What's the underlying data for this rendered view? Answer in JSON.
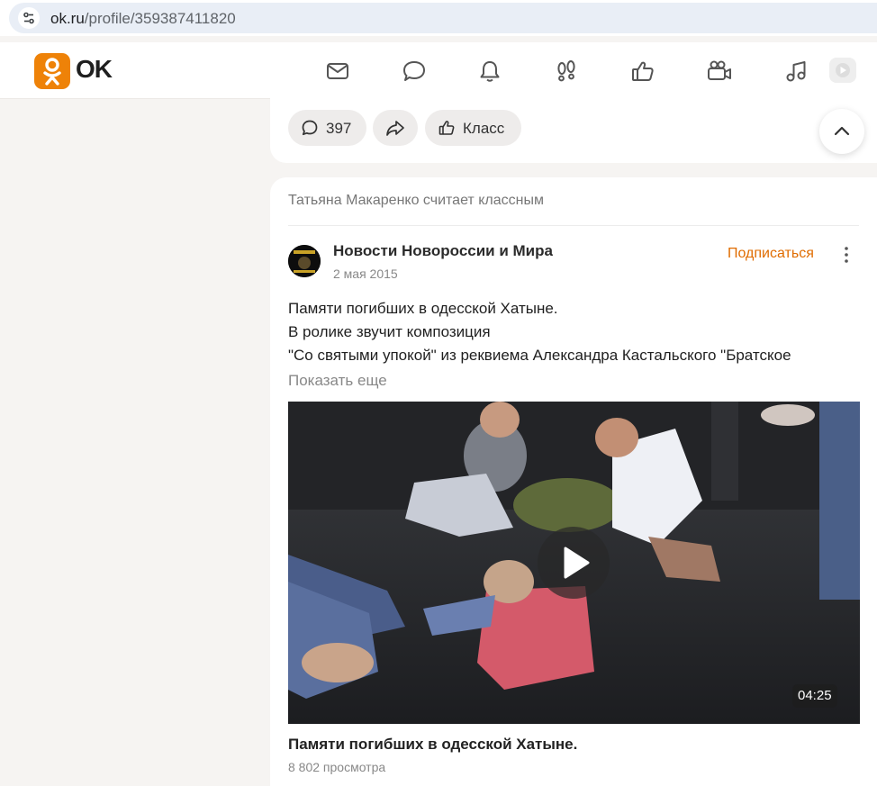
{
  "browser": {
    "url_host": "ok.ru",
    "url_path": "/profile/359387411820"
  },
  "header": {
    "logo_text": "OK",
    "nav_icons": [
      "mail-icon",
      "chat-icon",
      "bell-icon",
      "footprints-icon",
      "thumbs-up-icon",
      "video-camera-icon",
      "music-icon",
      "video-play-icon"
    ]
  },
  "prev_post": {
    "comments_count": "397",
    "class_label": "Класс"
  },
  "post": {
    "liked_by": "Татьяна Макаренко считает классным",
    "author": "Новости Новороссии и Мира",
    "date": "2 мая 2015",
    "subscribe_label": "Подписаться",
    "text_lines": [
      "Памяти погибших в одесской Хатыне.",
      "В ролике звучит композиция",
      "\"Со святыми упокой\" из реквиема Александра Кастальского \"Братское"
    ],
    "show_more": "Показать еще",
    "video": {
      "duration": "04:25",
      "title": "Памяти погибших в одесской Хатыне.",
      "views": "8 802 просмотра"
    }
  },
  "colors": {
    "accent": "#ee8208",
    "subscribe": "#e06c00",
    "page_bg": "#f6f4f2"
  }
}
